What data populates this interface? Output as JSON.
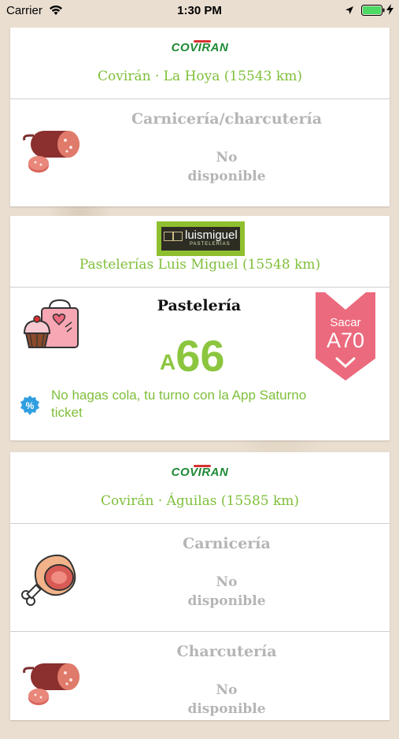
{
  "status_bar": {
    "carrier": "Carrier",
    "time": "1:30 PM"
  },
  "stores": [
    {
      "logo_text": "COVIRAN",
      "name": "Covirán · La Hoya (15543 km)",
      "sections": [
        {
          "category": "Carnicería/charcutería",
          "status_line1": "No",
          "status_line2": "disponible",
          "icon": "sausage-icon"
        }
      ]
    },
    {
      "logo_text": "luismiguel",
      "logo_sub": "PASTELERÍAS",
      "name": "Pastelerías Luis Miguel (15548 km)",
      "active": {
        "category": "Pastelería",
        "turn_prefix": "A",
        "turn_number": "66",
        "promo": "No hagas cola, tu turno con la App Saturno ticket",
        "promo_icon": "percent-badge-icon",
        "ticket_label": "Sacar",
        "ticket_code": "A70",
        "icon": "cake-icon",
        "colors": {
          "accent": "#8cc63f",
          "ticket": "#ec6a7d",
          "promo_badge": "#2f9fe0"
        }
      }
    },
    {
      "logo_text": "COVIRAN",
      "name": "Covirán · Águilas (15585 km)",
      "sections": [
        {
          "category": "Carnicería",
          "status_line1": "No",
          "status_line2": "disponible",
          "icon": "ham-icon"
        },
        {
          "category": "Charcutería",
          "status_line1": "No",
          "status_line2": "disponible",
          "icon": "sausage-icon"
        }
      ]
    }
  ]
}
